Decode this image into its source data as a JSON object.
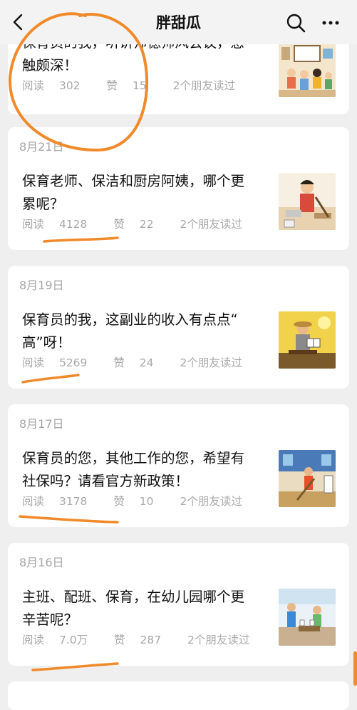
{
  "header": {
    "title": "胖甜瓜",
    "icons": {
      "back": "back-chevron-icon",
      "search": "search-icon",
      "more": "more-dots-icon"
    }
  },
  "articles": [
    {
      "date": "",
      "title_lines": [
        "保育员的我，听讲师德师风会议，感",
        "触颇深！"
      ],
      "reads_label": "阅读",
      "reads": "302",
      "likes_label": "赞",
      "likes": "15",
      "friends": "2个朋友读过",
      "thumb_icon": "classroom-illustration"
    },
    {
      "date": "8月21日",
      "title_lines": [
        "保育老师、保洁和厨房阿姨，哪个更",
        "累呢？"
      ],
      "reads_label": "阅读",
      "reads": "4128",
      "likes_label": "赞",
      "likes": "22",
      "friends": "2个朋友读过",
      "thumb_icon": "cleaning-lady-illustration"
    },
    {
      "date": "8月19日",
      "title_lines": [
        "保育员的我，这副业的收入有点点“",
        "高”呀！"
      ],
      "reads_label": "阅读",
      "reads": "5269",
      "likes_label": "赞",
      "likes": "24",
      "friends": "2个朋友读过",
      "thumb_icon": "reading-man-illustration"
    },
    {
      "date": "8月17日",
      "title_lines": [
        "保育员的您，其他工作的您，希望有",
        "社保吗？请看官方新政策！"
      ],
      "reads_label": "阅读",
      "reads": "3178",
      "likes_label": "赞",
      "likes": "10",
      "friends": "2个朋友读过",
      "thumb_icon": "sweeping-illustration"
    },
    {
      "date": "8月16日",
      "title_lines": [
        "主班、配班、保育，在幼儿园哪个更",
        "辛苦呢？"
      ],
      "reads_label": "阅读",
      "reads": "7.0万",
      "likes_label": "赞",
      "likes": "287",
      "friends": "2个朋友读过",
      "thumb_icon": "kindergarten-teachers-illustration"
    }
  ],
  "colors": {
    "background": "#efefef",
    "card": "#ffffff",
    "meta_text": "#a9a9a9",
    "annotation_orange": "#f08a2a"
  }
}
